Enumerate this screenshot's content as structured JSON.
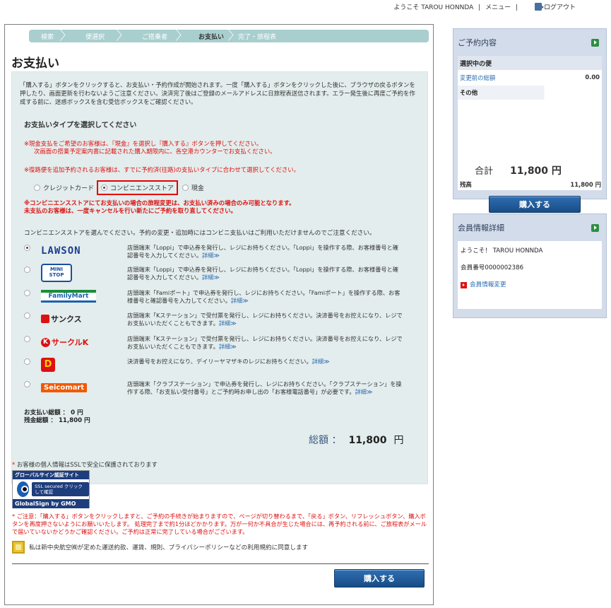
{
  "header": {
    "welcome": "ようこそ TAROU HONNDA",
    "sep1": "|",
    "menu": "メニュー",
    "sep2": "|",
    "logout": "ログアウト"
  },
  "steps": [
    "検索",
    "便選択",
    "ご搭乗者",
    "お支払い",
    "完了・旅程表"
  ],
  "page": {
    "title": "お支払い",
    "intro": "「購入する」ボタンをクリックすると、お支払い・予約作成が開始されます。一度「購入する」ボタンをクリックした後に、ブラウザの戻るボタンを押したり、画面更新を行わないようご注意ください。決済完了後はご登録のメールアドレスに日旅程表送信されます。エラー発生後に再度ご予約を作成する前に、迷惑ボックスを含む受信ボックスをご確認ください。",
    "section_title": "お支払いタイプを選択してください",
    "note_cash_1": "※現金支払をご希望のお客様は、『現金』を選択し『購入する』ボタンを押してください。",
    "note_cash_2": "次画面の搭乗予定案内書に記載された購入期限内に、各空港カウンターでお支払ください。",
    "note_return": "※復路便を追加予約されるお客様は、すでに予約済(往路)の支払いタイプに合わせて選択してください。",
    "note_conv_1": "※コンビニエンスストアにてお支払いの場合の旅程変更は、お支払い済みの場合のみ可能となります。",
    "note_conv_2": "未支払のお客様は、一度キャンセルを行い新たにご予約を取り直してください。",
    "store_note": "コンビニエンスストアを選んでください。予約の変更・追加時にはコンビニ支払いはご利用いただけませんのでご注意ください。",
    "detail": "詳細≫",
    "paid_total": "お支払い総額 ： 0 円",
    "remaining_total": "残金総額 ： 11,800 円",
    "grand_label": "総額 ：",
    "grand_value": "11,800",
    "grand_unit": "円",
    "ssl_note": "お客様の個人情報はSSLで安全に保護されております",
    "warning": "ご注意：「購入する」ボタンをクリックしますと、ご予約の手続きが始まりますので、ページが切り替わるまで、「戻る」ボタン、リフレッシュボタン、購入ボタンを再度押さないようにお願いいたします。 処理完了まで約1分ほどかかります。万が一何か不具合が生じた場合には、再予約される前に、ご旅程表がメールで届いていないかどうかご確認ください。ご予約は正常に完了している場合がございます。",
    "agree_text": "私は新中央航空㈱が定めた運送約款、運賃、規則、プライバシーポリシーなどの利用規約に同意します",
    "buy_label": "購入する"
  },
  "pay_types": [
    {
      "label": "クレジットカード",
      "selected": false
    },
    {
      "label": "コンビニエンスストア",
      "selected": true
    },
    {
      "label": "現金",
      "selected": false
    }
  ],
  "stores": [
    {
      "name": "LAWSON",
      "desc": "店頭端末「Loppi」で申込券を発行し、レジにお持ちください。「Loppi」を操作する際、お客様番号と確認番号を入力してください。"
    },
    {
      "name": "MINI STOP",
      "desc": "店頭端末「Loppi」で申込券を発行し、レジにお持ちください。「Loppi」を操作する際、お客様番号と確認番号を入力してください。"
    },
    {
      "name": "FamilyMart",
      "desc": "店頭端末「Famiポート」で申込券を発行し、レジにお持ちください。「Famiポート」を操作する際、お客様番号と確認番号を入力してください。"
    },
    {
      "name": "サンクス",
      "desc": "店頭端末「Kステーション」で受付票を発行し、レジにお持ちください。決済番号をお控えになり、レジでお支払いいただくこともできます。"
    },
    {
      "name": "サークルK",
      "desc": "店頭端末「Kステーション」で受付票を発行し、レジにお持ちください。決済番号をお控えになり、レジでお支払いいただくこともできます。"
    },
    {
      "name": "D",
      "desc": "決済番号をお控えになり、デイリーヤマザキのレジにお持ちください。"
    },
    {
      "name": "Seicomart",
      "desc": "店頭端末「クラブステーション」で申込券を発行し、レジにお持ちください。「クラブステーション」を操作する際、「お支払い受付番号」とご予約時お申し出の「お客様電話番号」が必要です。"
    }
  ],
  "badge": {
    "top": "グローバルサイン認証サイト",
    "ssl": "SSL secured クリックして確認",
    "bottom": "GlobalSign by GMO"
  },
  "sidebar": {
    "reservation": {
      "title": "ご予約内容",
      "selected_flight": "選択中の便",
      "before_change_label": "変更前の総額",
      "before_change_value": "0.00",
      "other": "その他",
      "total_label": "合計",
      "total_value": "11,800 円",
      "balance_label": "残高",
      "balance_value": "11,800 円",
      "buy_label": "購入する"
    },
    "member": {
      "title": "会員情報詳細",
      "welcome": "ようこそ！ TAROU HONNDA",
      "number": "会員番号0000002386",
      "change": "会員情報変更"
    }
  }
}
